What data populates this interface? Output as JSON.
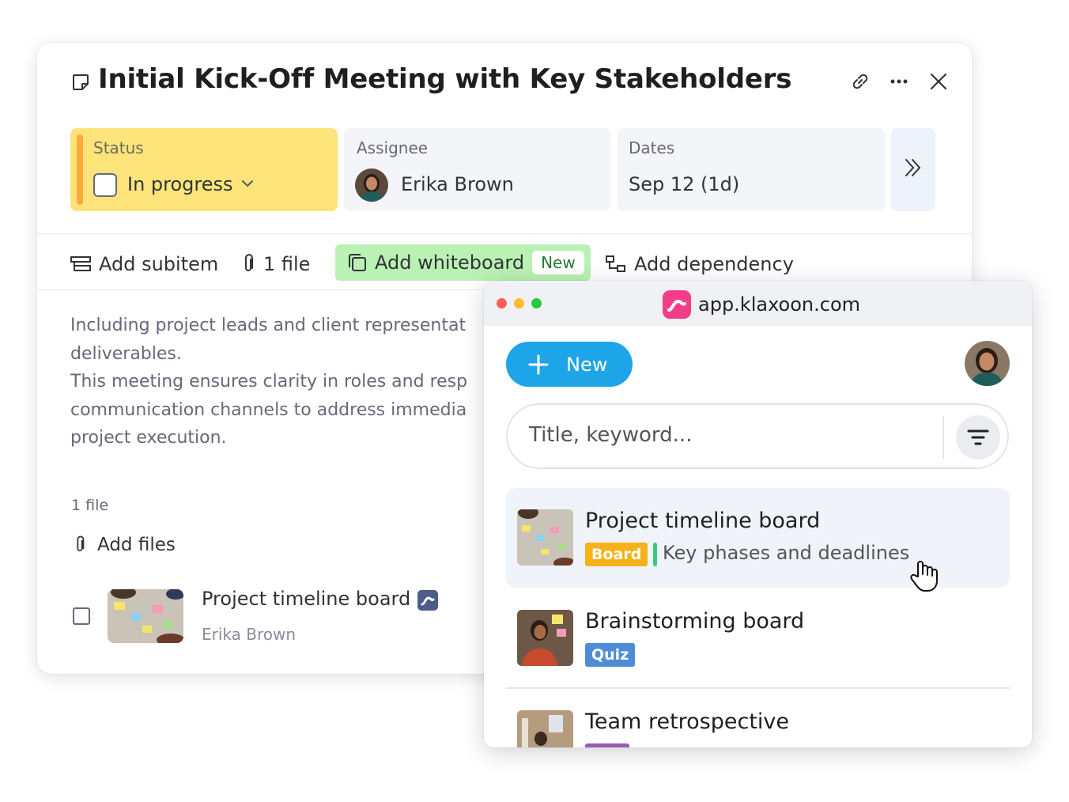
{
  "task": {
    "title": "Initial Kick-Off Meeting with Key Stakeholders",
    "status": {
      "label": "Status",
      "value": "In progress",
      "color": "#fde47a",
      "accent": "#ffa93b"
    },
    "assignee": {
      "label": "Assignee",
      "name": "Erika Brown"
    },
    "dates": {
      "label": "Dates",
      "value": "Sep 12 (1d)"
    },
    "actions": {
      "add_subitem": "Add subitem",
      "files": "1 file",
      "add_whiteboard": "Add whiteboard",
      "new_badge": "New",
      "add_dependency": "Add dependency"
    },
    "description": [
      "Including project leads and client representat",
      "deliverables.",
      "This meeting ensures clarity in roles and resp",
      "communication channels to address immedia",
      "project execution."
    ],
    "files_section": {
      "count_label": "1 file",
      "add_files": "Add files",
      "file": {
        "name": "Project timeline board",
        "owner": "Erika Brown"
      }
    }
  },
  "popup": {
    "url": "app.klaxoon.com",
    "new_button": "New",
    "search_placeholder": "Title, keyword...",
    "accent": "#1ea5e8",
    "items": [
      {
        "title": "Project timeline board",
        "tag": "Board",
        "tag_color": "#f6b21a",
        "description": "Key phases and deadlines"
      },
      {
        "title": "Brainstorming board",
        "tag": "Quiz",
        "tag_color": "#4e8dd6"
      },
      {
        "title": "Team retrospective"
      }
    ]
  }
}
